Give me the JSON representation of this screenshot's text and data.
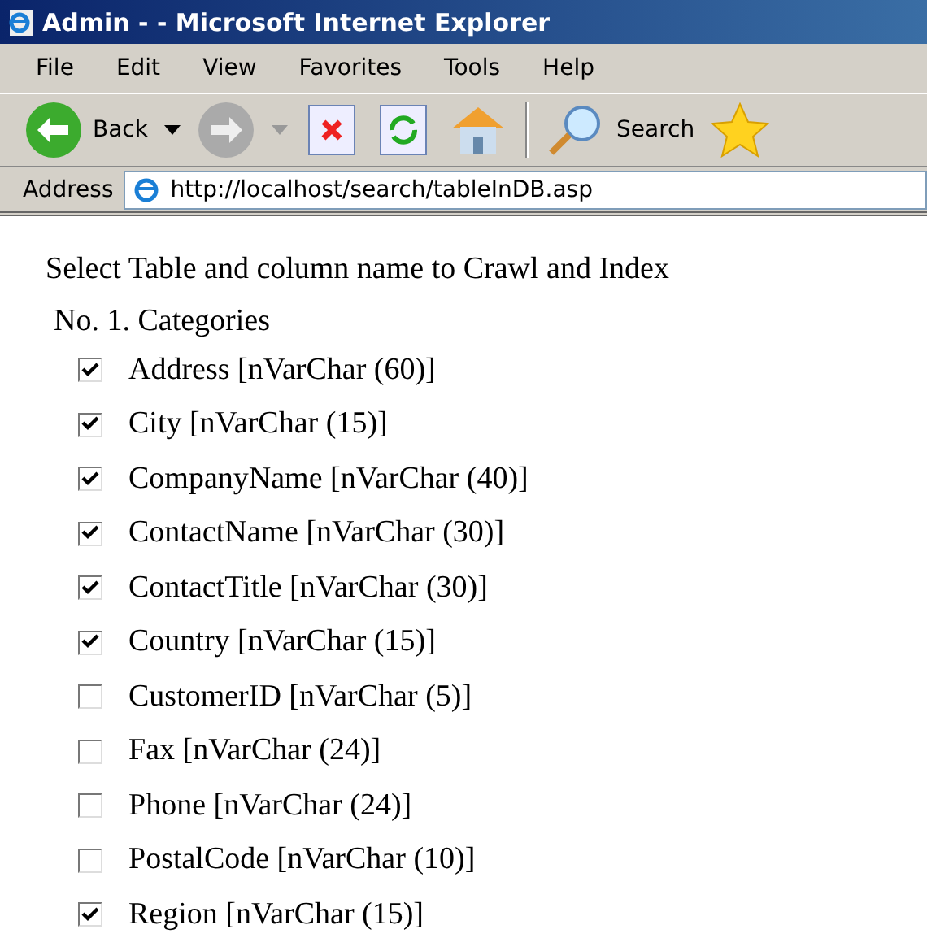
{
  "window": {
    "title": "Admin - - Microsoft Internet Explorer"
  },
  "menu": [
    "File",
    "Edit",
    "View",
    "Favorites",
    "Tools",
    "Help"
  ],
  "toolbar": {
    "back": "Back",
    "search": "Search"
  },
  "address": {
    "label": "Address",
    "value": "http://localhost/search/tableInDB.asp"
  },
  "heading": "Select Table and column name to Crawl and Index",
  "table_title": "No. 1. Categories",
  "columns": [
    {
      "label": "Address [nVarChar (60)]",
      "checked": true
    },
    {
      "label": "City [nVarChar (15)]",
      "checked": true
    },
    {
      "label": "CompanyName [nVarChar (40)]",
      "checked": true
    },
    {
      "label": "ContactName [nVarChar (30)]",
      "checked": true
    },
    {
      "label": "ContactTitle [nVarChar (30)]",
      "checked": true
    },
    {
      "label": "Country [nVarChar (15)]",
      "checked": true
    },
    {
      "label": "CustomerID [nVarChar (5)]",
      "checked": false
    },
    {
      "label": "Fax [nVarChar (24)]",
      "checked": false
    },
    {
      "label": "Phone [nVarChar (24)]",
      "checked": false
    },
    {
      "label": "PostalCode [nVarChar (10)]",
      "checked": false
    },
    {
      "label": "Region [nVarChar (15)]",
      "checked": true
    }
  ]
}
